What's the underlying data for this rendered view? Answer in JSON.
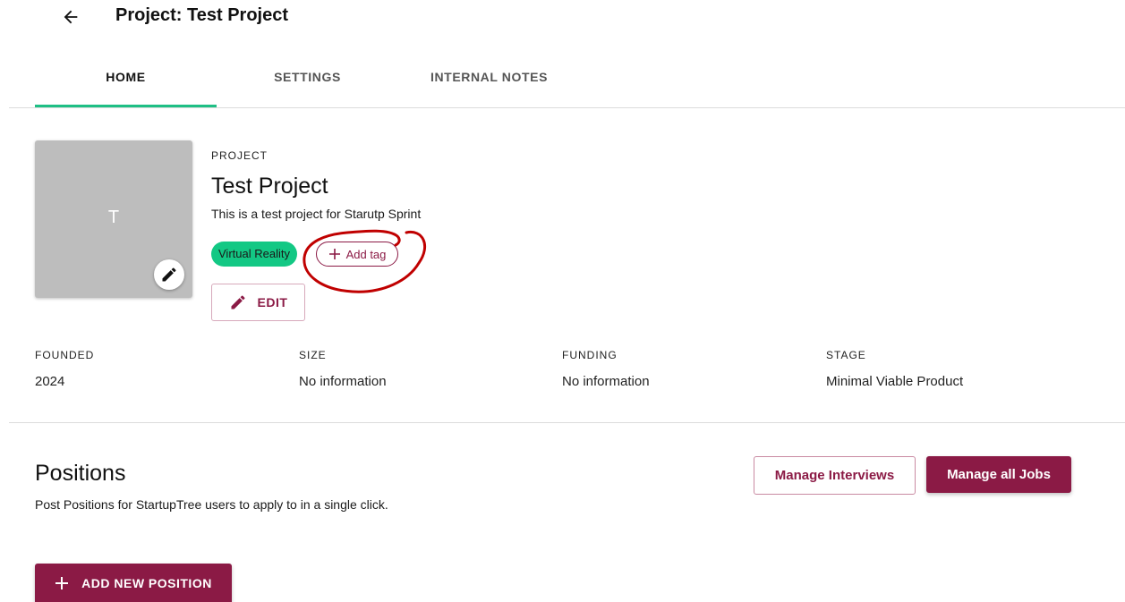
{
  "header": {
    "back_icon": "arrow-left-icon",
    "title": "Project: Test Project"
  },
  "tabs": [
    {
      "label": "HOME",
      "active": true
    },
    {
      "label": "SETTINGS",
      "active": false
    },
    {
      "label": "INTERNAL NOTES",
      "active": false
    }
  ],
  "project": {
    "avatar_letter": "T",
    "avatar_edit_icon": "pencil-icon",
    "overline": "PROJECT",
    "name": "Test Project",
    "description": "This is a test project for Starutp Sprint",
    "tags": [
      "Virtual Reality"
    ],
    "add_tag_icon": "plus-icon",
    "add_tag_label": "Add tag",
    "edit_icon": "pencil-icon",
    "edit_label": "EDIT"
  },
  "stats": [
    {
      "label": "FOUNDED",
      "value": "2024"
    },
    {
      "label": "SIZE",
      "value": "No information"
    },
    {
      "label": "FUNDING",
      "value": "No information"
    },
    {
      "label": "STAGE",
      "value": "Minimal Viable Product"
    }
  ],
  "positions": {
    "title": "Positions",
    "description": "Post Positions for StartupTree users to apply to in a single click.",
    "manage_interviews_label": "Manage Interviews",
    "manage_jobs_label": "Manage all Jobs",
    "add_icon": "plus-icon",
    "add_position_label": "ADD NEW POSITION"
  },
  "colors": {
    "accent": "#8b1a45",
    "tab_indicator": "#1fbf85",
    "tag_background": "#13c884",
    "annotation": "#c00000"
  }
}
